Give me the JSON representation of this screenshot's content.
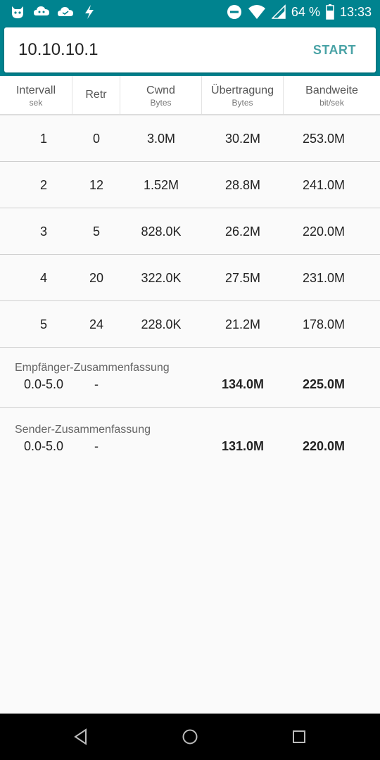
{
  "status_bar": {
    "battery": "64 %",
    "time": "13:33",
    "left_icons": [
      "app-icon-1",
      "app-icon-2",
      "app-icon-3",
      "flash-icon"
    ],
    "right_icons": [
      "do-not-disturb-icon",
      "wifi-icon",
      "signal-icon",
      "battery-icon"
    ]
  },
  "colors": {
    "primary": "#00838f",
    "accent": "#4aa3a6"
  },
  "host_input": {
    "value": "10.10.10.1"
  },
  "start_label": "START",
  "table": {
    "columns": [
      {
        "label": "Intervall",
        "unit": "sek"
      },
      {
        "label": "Retr",
        "unit": ""
      },
      {
        "label": "Cwnd",
        "unit": "Bytes"
      },
      {
        "label": "Übertragung",
        "unit": "Bytes"
      },
      {
        "label": "Bandweite",
        "unit": "bit/sek"
      }
    ],
    "rows": [
      [
        "1",
        "0",
        "3.0M",
        "30.2M",
        "253.0M"
      ],
      [
        "2",
        "12",
        "1.52M",
        "28.8M",
        "241.0M"
      ],
      [
        "3",
        "5",
        "828.0K",
        "26.2M",
        "220.0M"
      ],
      [
        "4",
        "20",
        "322.0K",
        "27.5M",
        "231.0M"
      ],
      [
        "5",
        "24",
        "228.0K",
        "21.2M",
        "178.0M"
      ]
    ]
  },
  "summaries": [
    {
      "title": "Empfänger-Zusammenfassung",
      "interval": "0.0-5.0",
      "retr": "-",
      "transfer": "134.0M",
      "bandwidth": "225.0M"
    },
    {
      "title": "Sender-Zusammenfassung",
      "interval": "0.0-5.0",
      "retr": "-",
      "transfer": "131.0M",
      "bandwidth": "220.0M"
    }
  ],
  "nav": [
    "back-icon",
    "home-icon",
    "recents-icon"
  ]
}
